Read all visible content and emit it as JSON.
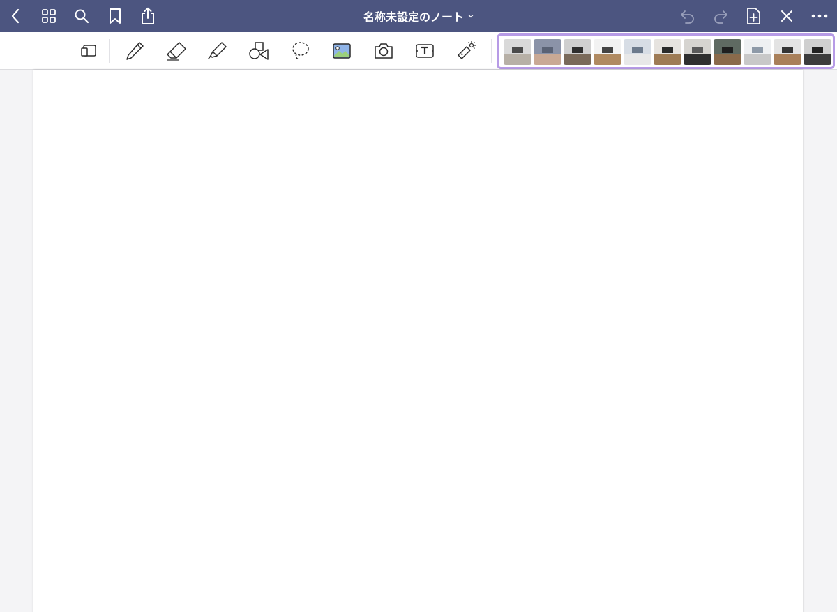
{
  "app": {
    "title": "名称未設定のノート"
  },
  "topbar": {
    "left_icons": [
      "back-icon",
      "grid-icon",
      "search-icon",
      "bookmark-icon",
      "share-icon"
    ],
    "right_icons": [
      "undo-icon",
      "redo-icon",
      "add-page-icon",
      "close-icon",
      "more-icon"
    ]
  },
  "toolbar": {
    "tools": [
      "page-layout-icon",
      "pen-icon",
      "eraser-icon",
      "highlighter-icon",
      "shapes-icon",
      "lasso-icon",
      "image-icon",
      "camera-icon",
      "text-box-icon",
      "laser-pointer-icon"
    ]
  },
  "thumbnails": {
    "count": 11,
    "items": [
      {
        "wall": "#d9d9d9",
        "desk": "#b7b0a6",
        "obj": "#4a4a4a"
      },
      {
        "wall": "#8b93a8",
        "desk": "#c9a995",
        "obj": "#5a6275"
      },
      {
        "wall": "#cfcfcf",
        "desk": "#7a6a5a",
        "obj": "#2e2e2e"
      },
      {
        "wall": "#f2f2f2",
        "desk": "#b08a61",
        "obj": "#444444"
      },
      {
        "wall": "#d7dde5",
        "desk": "#e8e8e8",
        "obj": "#6c7a8c"
      },
      {
        "wall": "#e6e3df",
        "desk": "#9e7b55",
        "obj": "#2b2b2b"
      },
      {
        "wall": "#d6d4d0",
        "desk": "#2f2f2f",
        "obj": "#5b5b5b"
      },
      {
        "wall": "#5f6a62",
        "desk": "#8a6a4b",
        "obj": "#1f1f1f"
      },
      {
        "wall": "#eef0f2",
        "desk": "#c8c8c8",
        "obj": "#8e9aa8"
      },
      {
        "wall": "#e3e3e3",
        "desk": "#a9805a",
        "obj": "#343434"
      },
      {
        "wall": "#cfcfcf",
        "desk": "#3c3c3c",
        "obj": "#222222"
      }
    ]
  },
  "colors": {
    "topbar": "#4c5580",
    "accent_border": "#b79be6",
    "icon_dark": "#2a2a2a"
  }
}
